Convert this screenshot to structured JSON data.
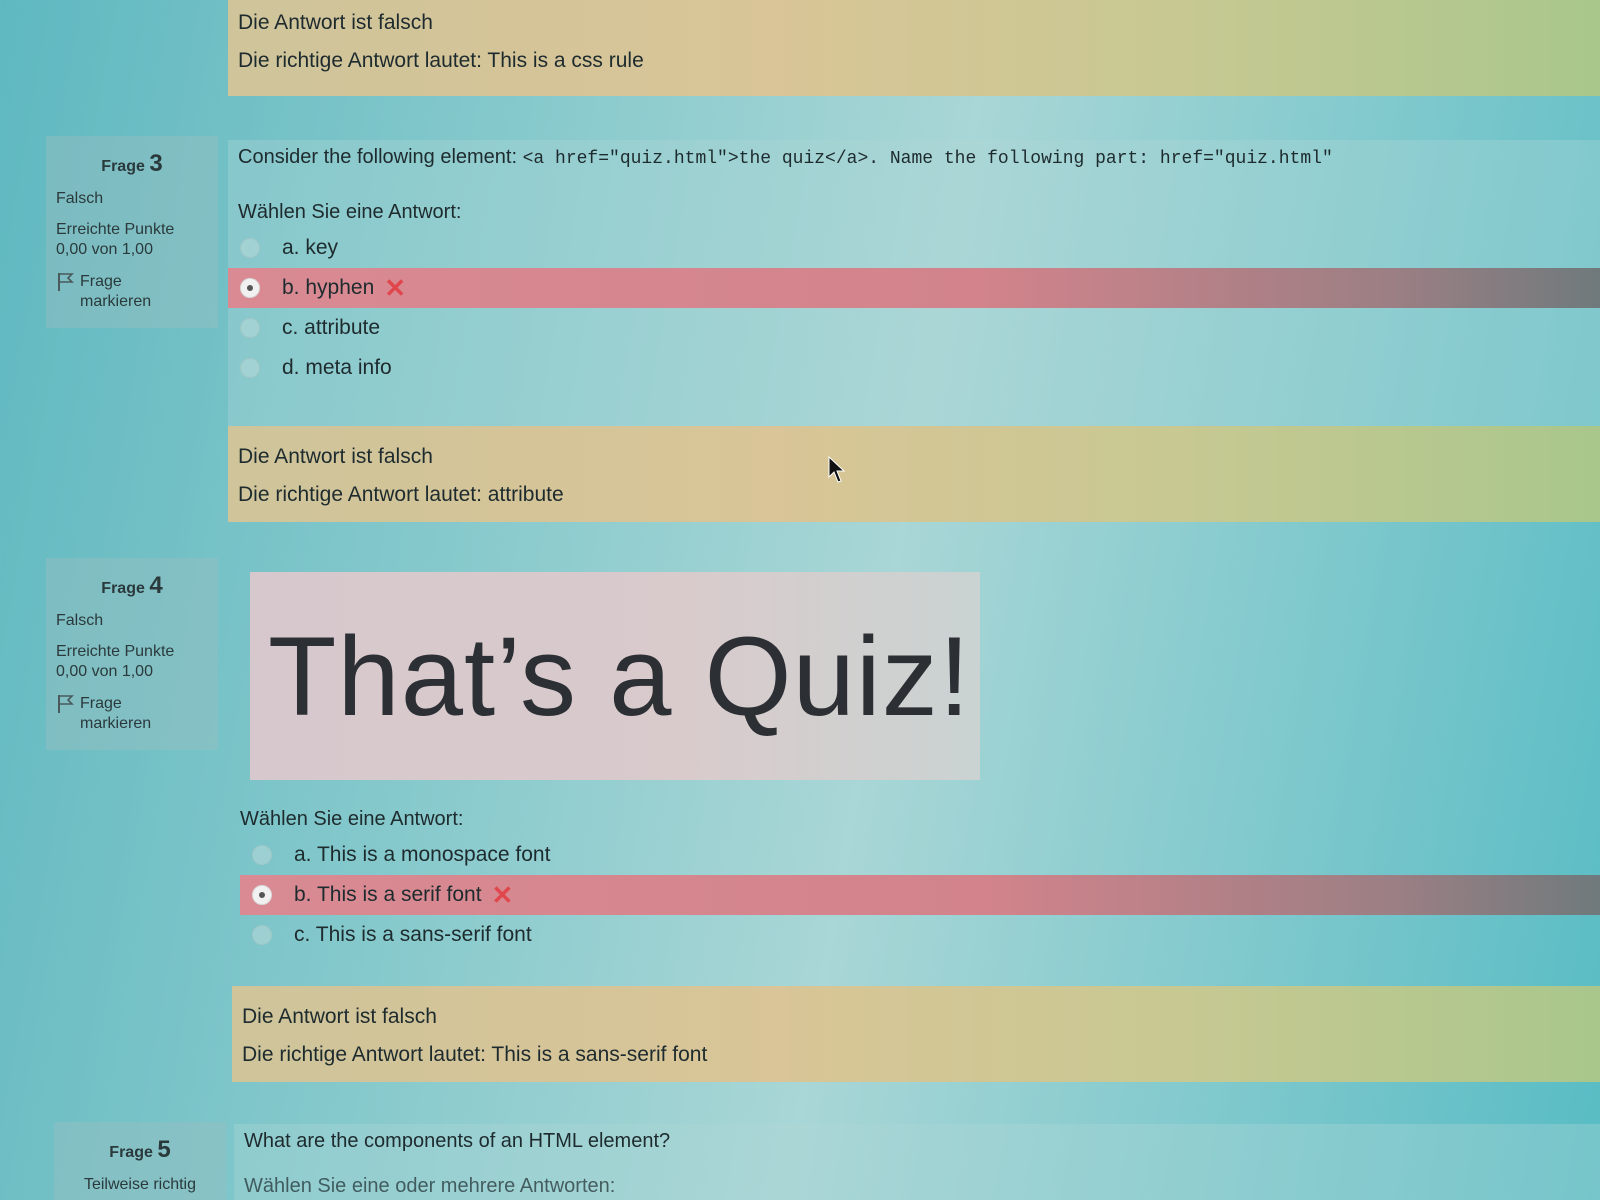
{
  "top_feedback": {
    "line1": "Die Antwort ist falsch",
    "line2": "Die richtige Antwort lautet: This is a css rule"
  },
  "q3": {
    "frage_label": "Frage",
    "number": "3",
    "state": "Falsch",
    "points_label": "Erreichte Punkte",
    "points_value": "0,00 von 1,00",
    "flag_line1": "Frage",
    "flag_line2": "markieren",
    "text_prefix": "Consider the following element: ",
    "text_code": "<a href=\"quiz.html\">the quiz</a>. Name the following part: href=\"quiz.html\"",
    "prompt": "Wählen Sie eine Antwort:",
    "options": [
      {
        "label": "a. key",
        "selected": false,
        "wrong": false
      },
      {
        "label": "b. hyphen",
        "selected": true,
        "wrong": true
      },
      {
        "label": "c. attribute",
        "selected": false,
        "wrong": false
      },
      {
        "label": "d. meta info",
        "selected": false,
        "wrong": false
      }
    ],
    "feedback_line1": "Die Antwort ist falsch",
    "feedback_line2": "Die richtige Antwort lautet: attribute"
  },
  "q4": {
    "frage_label": "Frage",
    "number": "4",
    "state": "Falsch",
    "points_label": "Erreichte Punkte",
    "points_value": "0,00 von 1,00",
    "flag_line1": "Frage",
    "flag_line2": "markieren",
    "image_text": "That’s a Quiz!",
    "prompt": "Wählen Sie eine Antwort:",
    "options": [
      {
        "label": "a. This is a monospace font",
        "selected": false,
        "wrong": false
      },
      {
        "label": "b. This is a serif font",
        "selected": true,
        "wrong": true
      },
      {
        "label": "c. This is a sans-serif font",
        "selected": false,
        "wrong": false
      }
    ],
    "feedback_line1": "Die Antwort ist falsch",
    "feedback_line2": "Die richtige Antwort lautet: This is a sans-serif font"
  },
  "q5": {
    "frage_label": "Frage",
    "number": "5",
    "state": "Teilweise richtig",
    "text": "What are the components of an HTML element?",
    "prompt": "Wählen Sie eine oder mehrere Antworten:"
  },
  "icons": {
    "wrong_mark": "✕",
    "flag": "flag-icon"
  },
  "colors": {
    "wrong_row": "#d98a92",
    "feedback_bg": "#d9c597",
    "wrong_mark": "#e0474d"
  }
}
